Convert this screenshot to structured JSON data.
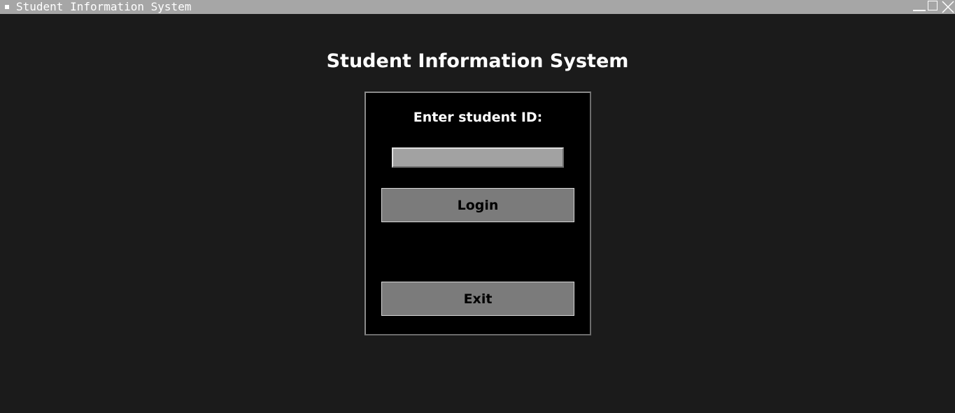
{
  "window": {
    "title": "Student Information System",
    "controls": {
      "minimize_icon": "minimize-icon",
      "maximize_icon": "maximize-icon",
      "close_icon": "close-icon"
    }
  },
  "main": {
    "heading": "Student Information System",
    "login_panel": {
      "prompt": "Enter student ID:",
      "student_id_value": "",
      "login_label": "Login",
      "exit_label": "Exit"
    }
  },
  "colors": {
    "background": "#1b1b1b",
    "titlebar": "#a6a6a6",
    "panel": "#000000",
    "input": "#a2a2a2",
    "button": "#7b7b7b"
  }
}
